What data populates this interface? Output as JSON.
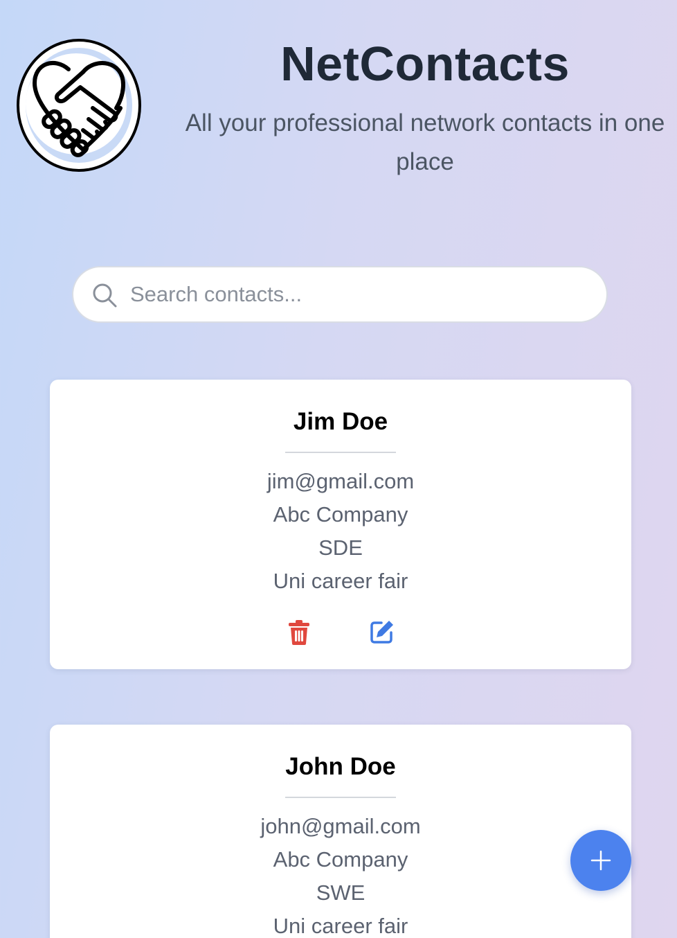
{
  "header": {
    "title": "NetContacts",
    "subtitle": "All your professional network contacts in one place",
    "logo_icon": "handshake-heart-icon"
  },
  "search": {
    "placeholder": "Search contacts...",
    "value": "",
    "icon": "search-icon"
  },
  "contacts": [
    {
      "name": "Jim Doe",
      "email": "jim@gmail.com",
      "company": "Abc Company",
      "role": "SDE",
      "met_at": "Uni career fair"
    },
    {
      "name": "John Doe",
      "email": "john@gmail.com",
      "company": "Abc Company",
      "role": "SWE",
      "met_at": "Uni career fair"
    }
  ],
  "actions": {
    "delete_icon": "trash-icon",
    "edit_icon": "edit-icon",
    "add_icon": "plus-icon"
  },
  "colors": {
    "accent": "#4c82ee",
    "delete": "#e0483e",
    "edit": "#3f7ae3",
    "title": "#1f2937",
    "detail_text": "#5b6270"
  }
}
